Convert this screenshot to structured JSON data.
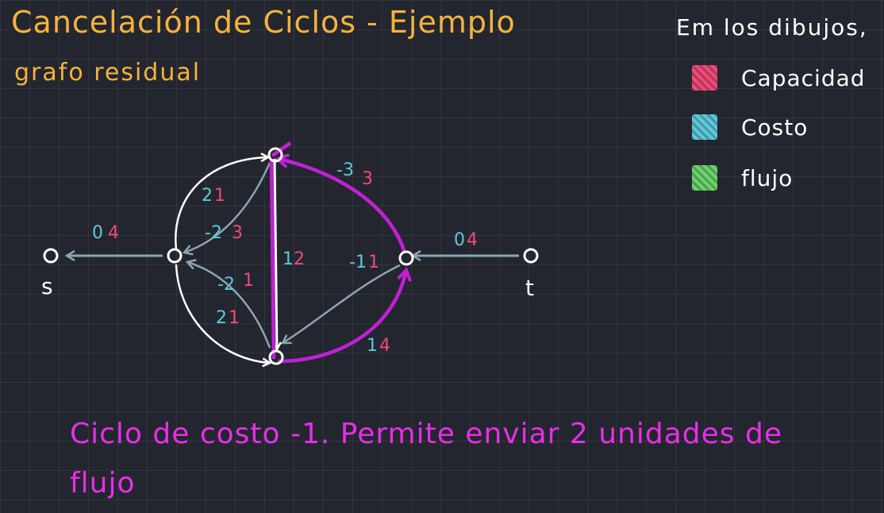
{
  "title": "Cancelación de Ciclos - Ejemplo",
  "subtitle": "grafo residual",
  "legend": {
    "intro": "Em los dibujos,",
    "items": [
      {
        "label": "Capacidad",
        "color": "#f04a77"
      },
      {
        "label": "Costo",
        "color": "#5ec8dc"
      },
      {
        "label": "flujo",
        "color": "#6ad46a"
      }
    ]
  },
  "nodes": {
    "s": "s",
    "t": "t"
  },
  "edge_labels": {
    "s_edge": {
      "cost": "0",
      "cap": "4"
    },
    "t_edge": {
      "cost": "0",
      "cap": "4"
    },
    "left_top_white": {
      "cost": "2",
      "cap": "1"
    },
    "top_left_back": {
      "cost": "-2",
      "cap": "3"
    },
    "bottom_left_back": {
      "cost": "-2",
      "cap": "1"
    },
    "left_bottom_white": {
      "cost": "2",
      "cap": "1"
    },
    "vertical": {
      "cost": "1",
      "cap": "2"
    },
    "right_top_purple": {
      "cost": "-3",
      "cap": "3"
    },
    "right_bottom_back": {
      "cost": "-1",
      "cap": "1"
    },
    "bottom_right_purple": {
      "cost": "1",
      "cap": "4"
    }
  },
  "colors": {
    "capacity": "#f04a77",
    "cost": "#5ec8dc",
    "cycle": "#c21fd6",
    "edge_white": "#ffffff",
    "edge_gray": "#8aa6b2",
    "title": "#f5b33d",
    "caption": "#e72ee7"
  },
  "caption": "Ciclo de costo -1. Permite enviar 2 unidades de flujo"
}
